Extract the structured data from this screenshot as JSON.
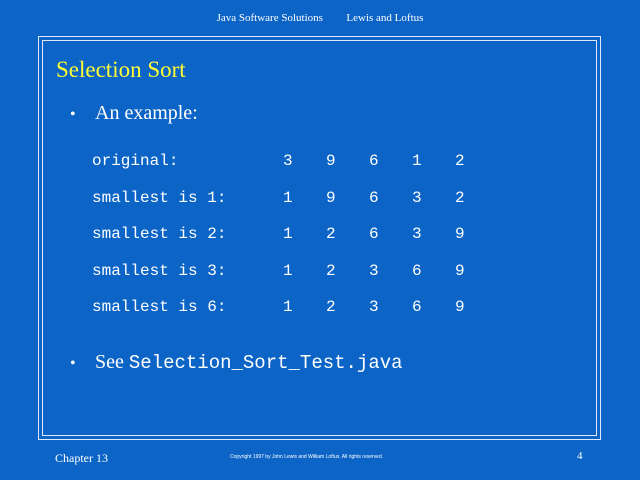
{
  "header": {
    "left": "Java Software Solutions",
    "right": "Lewis and Loftus"
  },
  "slide": {
    "title": "Selection Sort",
    "bullet1": "An example:",
    "bullet2_prefix": "See",
    "bullet2_code": "Selection_Sort_Test.java",
    "bullet_glyph": "•"
  },
  "table": {
    "rows": [
      {
        "label": "original:",
        "values": [
          "3",
          "9",
          "6",
          "1",
          "2"
        ]
      },
      {
        "label": "smallest is 1:",
        "values": [
          "1",
          "9",
          "6",
          "3",
          "2"
        ]
      },
      {
        "label": "smallest is 2:",
        "values": [
          "1",
          "2",
          "6",
          "3",
          "9"
        ]
      },
      {
        "label": "smallest is 3:",
        "values": [
          "1",
          "2",
          "3",
          "6",
          "9"
        ]
      },
      {
        "label": "smallest is 6:",
        "values": [
          "1",
          "2",
          "3",
          "6",
          "9"
        ]
      }
    ]
  },
  "footer": {
    "chapter": "Chapter 13",
    "copyright": "Copyright 1997 by John Lewis and William Loftus.  All rights reserved.",
    "page_number": "4"
  },
  "colors": {
    "background": "#0b64c6",
    "title": "#ffff33",
    "text": "#ffffff"
  }
}
